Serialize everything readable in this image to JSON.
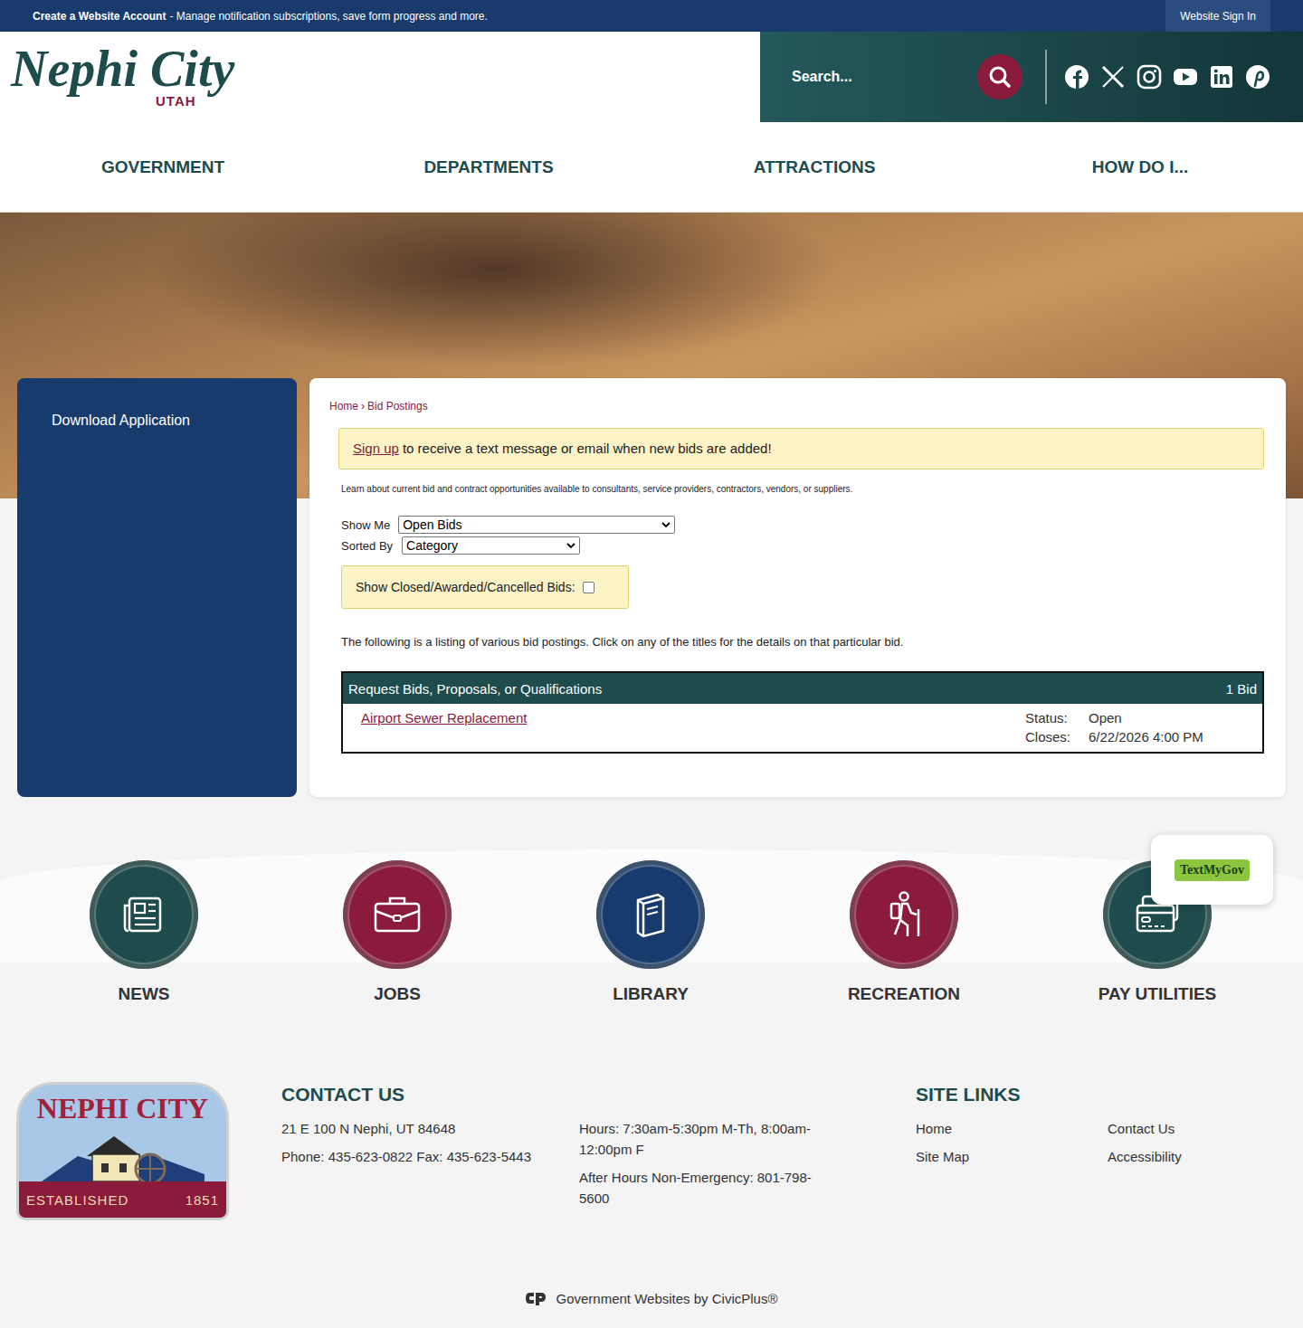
{
  "top_bar": {
    "account_link": "Create a Website Account",
    "account_text": "- Manage notification subscriptions, save form progress and more.",
    "sign_in": "Website Sign In"
  },
  "header": {
    "logo_title": "Nephi City",
    "logo_subtitle": "UTAH",
    "search_placeholder": "Search..."
  },
  "nav": [
    "GOVERNMENT",
    "DEPARTMENTS",
    "ATTRACTIONS",
    "HOW DO I..."
  ],
  "sidebar": {
    "items": [
      "Download Application"
    ]
  },
  "breadcrumb": {
    "items": [
      "Home",
      "Bid Postings"
    ],
    "separator": "›"
  },
  "alert": {
    "link": "Sign up",
    "text": "to receive a text message or email when new bids are added!"
  },
  "intro": "Learn about current bid and contract opportunities available to consultants, service providers, contractors, vendors, or suppliers.",
  "filters": [
    {
      "label": "Show Me",
      "value": "Open Bids"
    },
    {
      "label": "Sorted By",
      "value": "Category"
    }
  ],
  "show_closed": {
    "label": "Show Closed/Awarded/Cancelled Bids:",
    "checked": false
  },
  "listing_note": "The following is a listing of various bid postings. Click on any of the titles for the details on that particular bid.",
  "bid_table": {
    "category": "Request Bids, Proposals, or Qualifications",
    "count": "1 Bid",
    "rows": [
      {
        "title": "Airport Sewer Replacement",
        "status_label": "Status:",
        "status": "Open",
        "closes_label": "Closes:",
        "closes": "6/22/2026 4:00 PM"
      }
    ]
  },
  "quick_links": [
    {
      "label": "NEWS",
      "color": "#1e4b4c"
    },
    {
      "label": "JOBS",
      "color": "#8b1b3b"
    },
    {
      "label": "LIBRARY",
      "color": "#173b6d"
    },
    {
      "label": "RECREATION",
      "color": "#8b1b3b"
    },
    {
      "label": "PAY UTILITIES",
      "color": "#1e4b4c"
    }
  ],
  "textmygov": "TextMyGov",
  "footer": {
    "seal": {
      "title": "NEPHI CITY",
      "established": "ESTABLISHED",
      "year": "1851"
    },
    "contact_heading": "CONTACT US",
    "address": "21 E 100 N Nephi, UT 84648",
    "phone": "Phone: 435-623-0822 Fax: 435-623-5443",
    "hours": "Hours: 7:30am-5:30pm M-Th, 8:00am-12:00pm F",
    "after_hours": "After Hours Non-Emergency: 801-798-5600",
    "links_heading": "SITE LINKS",
    "links": [
      "Home",
      "Contact Us",
      "Site Map",
      "Accessibility"
    ]
  },
  "credit": "Government Websites by CivicPlus®"
}
